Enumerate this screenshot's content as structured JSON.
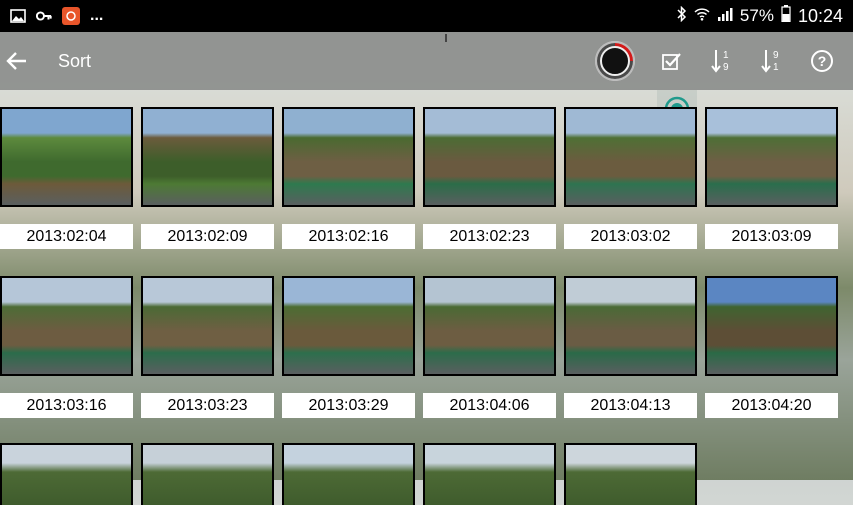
{
  "status": {
    "battery": "57%",
    "time": "10:24",
    "more": "..."
  },
  "toolbar": {
    "title": "Sort"
  },
  "photos": [
    {
      "date": "2013:02:04"
    },
    {
      "date": "2013:02:09"
    },
    {
      "date": "2013:02:16"
    },
    {
      "date": "2013:02:23"
    },
    {
      "date": "2013:03:02"
    },
    {
      "date": "2013:03:09"
    },
    {
      "date": "2013:03:16"
    },
    {
      "date": "2013:03:23"
    },
    {
      "date": "2013:03:29"
    },
    {
      "date": "2013:04:06"
    },
    {
      "date": "2013:04:13"
    },
    {
      "date": "2013:04:20"
    }
  ]
}
